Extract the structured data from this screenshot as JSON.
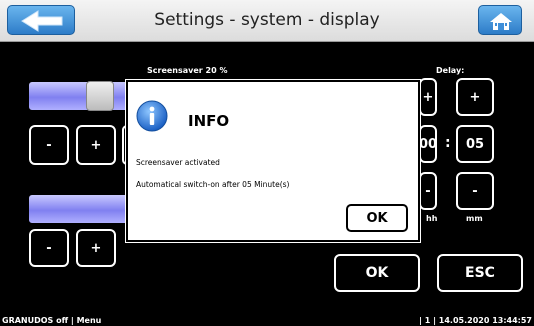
{
  "header": {
    "title": "Settings - system - display",
    "back_icon": "arrow-left-icon",
    "home_icon": "home-icon"
  },
  "screensaver": {
    "label": "Screensaver 20 %",
    "level": 0.2
  },
  "brightness": {
    "level": 0.3
  },
  "delay": {
    "label": "Delay:",
    "hours": "00",
    "minutes": "05",
    "hh_label": "hh",
    "mm_label": "mm",
    "separator": ":"
  },
  "buttons": {
    "minus": "-",
    "plus": "+",
    "ok": "OK",
    "esc": "ESC"
  },
  "dialog": {
    "title": "INFO",
    "icon": "info-icon",
    "message1": "Screensaver activated",
    "message2": "Automatical switch-on after 05 Minute(s)",
    "ok": "OK"
  },
  "footer": {
    "left": "GRANUDOS off | Menu",
    "right": "| 1 | 14.05.2020 13:44:57"
  },
  "colors": {
    "header_bg": "#e8e8e8",
    "header_button": "#3f8fd9",
    "slider_fill": "#8a8af2",
    "background": "#000000"
  }
}
